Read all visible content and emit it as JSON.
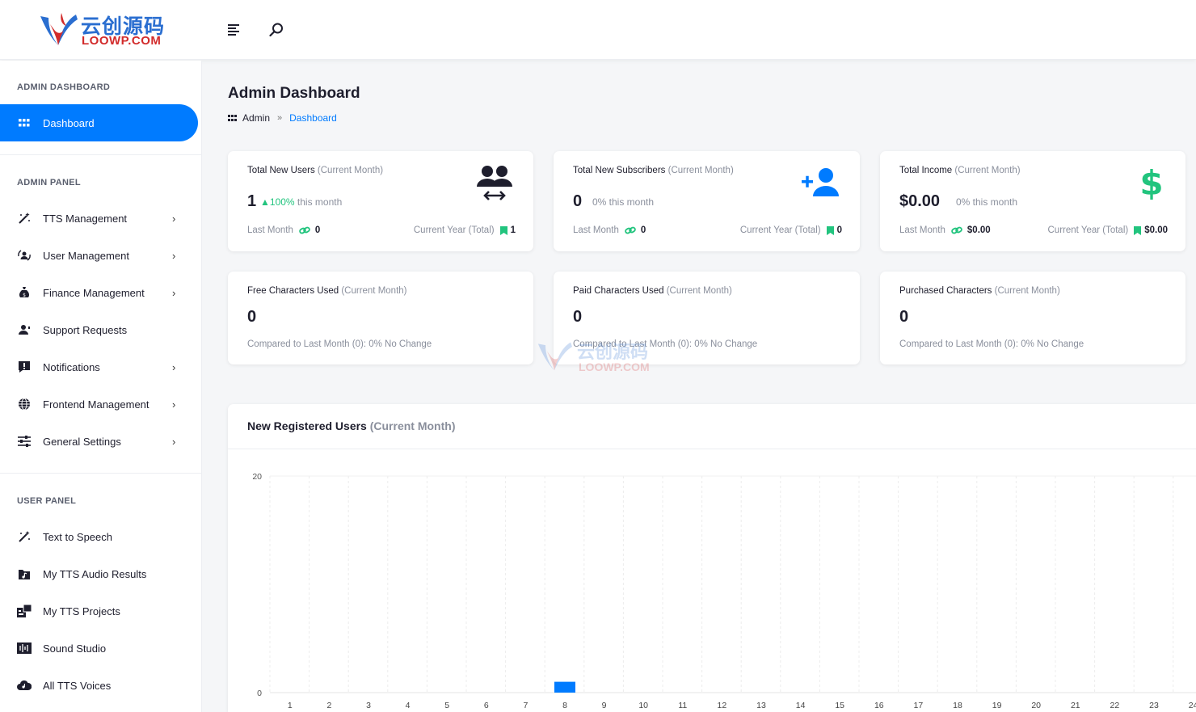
{
  "brand": {
    "name_cn": "云创源码",
    "name_en": "LOOWP.COM"
  },
  "sidebar": {
    "sections": [
      {
        "title": "ADMIN DASHBOARD"
      },
      {
        "title": "ADMIN PANEL"
      },
      {
        "title": "USER PANEL"
      }
    ],
    "dashboard": {
      "label": "Dashboard",
      "icon": "grid-icon"
    },
    "admin_items": [
      {
        "label": "TTS Management",
        "icon": "magic-wand-icon"
      },
      {
        "label": "User Management",
        "icon": "user-sync-icon"
      },
      {
        "label": "Finance Management",
        "icon": "money-bag-icon"
      },
      {
        "label": "Support Requests",
        "icon": "headset-user-icon"
      },
      {
        "label": "Notifications",
        "icon": "alert-message-icon"
      },
      {
        "label": "Frontend Management",
        "icon": "globe-icon"
      },
      {
        "label": "General Settings",
        "icon": "sliders-icon"
      }
    ],
    "user_items": [
      {
        "label": "Text to Speech",
        "icon": "magic-wand-icon"
      },
      {
        "label": "My TTS Audio Results",
        "icon": "music-folder-icon"
      },
      {
        "label": "My TTS Projects",
        "icon": "projects-icon"
      },
      {
        "label": "Sound Studio",
        "icon": "studio-icon"
      },
      {
        "label": "All TTS Voices",
        "icon": "cloud-voice-icon"
      }
    ]
  },
  "header": {
    "page_title": "Admin Dashboard",
    "breadcrumb": {
      "home": "Admin",
      "current": "Dashboard"
    }
  },
  "stats": [
    {
      "title": "Total New Users",
      "title_suffix": "(Current Month)",
      "value": "1",
      "change": "100%",
      "change_suffix": " this month",
      "last_month_label": "Last Month",
      "last_month_value": "0",
      "year_label": "Current Year (Total)",
      "year_value": "1",
      "icon": "users-transfer-icon",
      "icon_color": "#1e1e2d"
    },
    {
      "title": "Total New Subscribers",
      "title_suffix": "(Current Month)",
      "value": "0",
      "change": "0%",
      "change_suffix": " this month",
      "last_month_label": "Last Month",
      "last_month_value": "0",
      "year_label": "Current Year (Total)",
      "year_value": "0",
      "icon": "add-user-icon",
      "icon_color": "#007bff"
    },
    {
      "title": "Total Income",
      "title_suffix": "(Current Month)",
      "value": "$0.00",
      "change": "0%",
      "change_suffix": " this month",
      "last_month_label": "Last Month",
      "last_month_value": "$0.00",
      "year_label": "Current Year (Total)",
      "year_value": "$0.00",
      "icon": "dollar-icon",
      "icon_color": "#22c47e"
    }
  ],
  "chars": [
    {
      "title": "Free Characters Used",
      "title_suffix": "(Current Month)",
      "value": "0",
      "compare": "Compared to Last Month (0): 0% No Change"
    },
    {
      "title": "Paid Characters Used",
      "title_suffix": "(Current Month)",
      "value": "0",
      "compare": "Compared to Last Month (0): 0% No Change"
    },
    {
      "title": "Purchased Characters",
      "title_suffix": "(Current Month)",
      "value": "0",
      "compare": "Compared to Last Month (0): 0% No Change"
    }
  ],
  "chart": {
    "title": "New Registered Users",
    "title_suffix": "(Current Month)"
  },
  "chart_data": {
    "type": "bar",
    "categories": [
      "1",
      "2",
      "3",
      "4",
      "5",
      "6",
      "7",
      "8",
      "9",
      "10",
      "11",
      "12",
      "13",
      "14",
      "15",
      "16",
      "17",
      "18",
      "19",
      "20",
      "21",
      "22",
      "23",
      "24"
    ],
    "values": [
      0,
      0,
      0,
      0,
      0,
      0,
      0,
      1,
      0,
      0,
      0,
      0,
      0,
      0,
      0,
      0,
      0,
      0,
      0,
      0,
      0,
      0,
      0,
      0
    ],
    "ylim": [
      0,
      20
    ],
    "yticks": [
      "0",
      "20"
    ],
    "grid": true,
    "bar_color": "#007bff"
  },
  "colors": {
    "accent": "#007bff",
    "positive": "#22c47e"
  }
}
